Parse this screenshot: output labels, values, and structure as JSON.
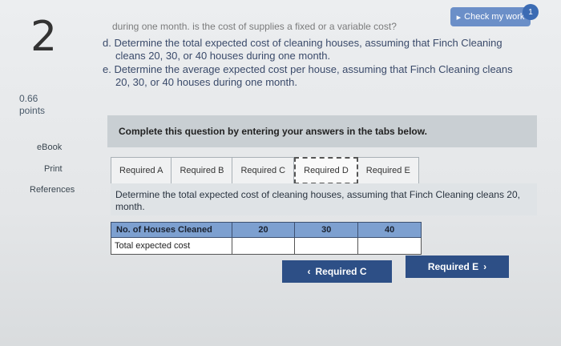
{
  "question": {
    "number": "2",
    "points_value": "0.66",
    "points_label": "points",
    "prompt_partial": "during one month. is the cost of supplies a fixed or a variable cost?",
    "item_d_line1": "d. Determine the total expected cost of cleaning houses, assuming that Finch Cleaning",
    "item_d_line2": "cleans 20, 30, or 40 houses during one month.",
    "item_e_line1": "e. Determine the average expected cost per house, assuming that Finch Cleaning cleans",
    "item_e_line2": "20, 30, or 40 houses during one month."
  },
  "header": {
    "check_label": "Check my work",
    "check_badge": "1"
  },
  "sidebar": {
    "ebook": "eBook",
    "print": "Print",
    "references": "References"
  },
  "panel": {
    "title": "Complete this question by entering your answers in the tabs below.",
    "tabs": [
      {
        "label": "Required A"
      },
      {
        "label": "Required B"
      },
      {
        "label": "Required C"
      },
      {
        "label": "Required D"
      },
      {
        "label": "Required E"
      }
    ],
    "instruction": "Determine the total expected cost of cleaning houses, assuming that Finch Cleaning cleans 20, month."
  },
  "table": {
    "row_header": "No. of Houses Cleaned",
    "columns": [
      "20",
      "30",
      "40"
    ],
    "row_label": "Total expected cost"
  },
  "nav": {
    "prev_label": "Required C",
    "next_label": "Required E"
  },
  "colors": {
    "accent": "#2d4f86",
    "table_header": "#7da0d0",
    "check_button": "#6b8fc8"
  }
}
